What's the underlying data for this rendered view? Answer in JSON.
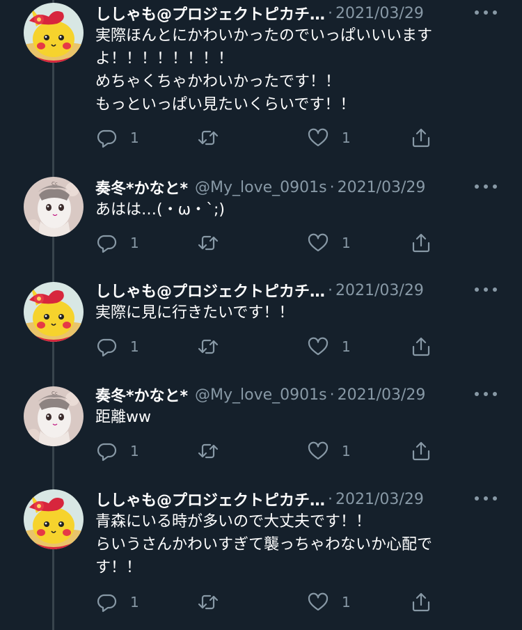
{
  "tweets": [
    {
      "author": "pikachu",
      "name": "ししゃも@プロジェクトピカチ…",
      "handle": "",
      "separator": "·",
      "date": "2021/03/29",
      "text": "実際ほんとにかわいかったのでいっぱいいいます\nよ！！！！！！！！\nめちゃくちゃかわいかったです！！\nもっといっぱい見たいくらいです！！",
      "reply_count": "1",
      "like_count": "1"
    },
    {
      "author": "kanato",
      "name": "奏冬*かなと*",
      "handle": "@My_love_0901s",
      "separator": "·",
      "date": "2021/03/29",
      "text": "あはは…(・ω・`;)",
      "reply_count": "1",
      "like_count": "1"
    },
    {
      "author": "pikachu",
      "name": "ししゃも@プロジェクトピカチ…",
      "handle": "",
      "separator": "·",
      "date": "2021/03/29",
      "text": "実際に見に行きたいです！！",
      "reply_count": "1",
      "like_count": "1"
    },
    {
      "author": "kanato",
      "name": "奏冬*かなと*",
      "handle": "@My_love_0901s",
      "separator": "·",
      "date": "2021/03/29",
      "text": "距離ww",
      "reply_count": "1",
      "like_count": "1"
    },
    {
      "author": "pikachu",
      "name": "ししゃも@プロジェクトピカチ…",
      "handle": "",
      "separator": "·",
      "date": "2021/03/29",
      "text": "青森にいる時が多いので大丈夫です！！\nらいうさんかわいすぎて襲っちゃわないか心配で\nす！！",
      "reply_count": "1",
      "like_count": "1"
    }
  ],
  "icons": {
    "reply": "reply-icon",
    "retweet": "retweet-icon",
    "like": "heart-icon",
    "share": "share-icon",
    "more": "more-icon"
  },
  "colors": {
    "background": "#15202b",
    "secondary_text": "#8899a6",
    "thread_line": "#38444d"
  }
}
